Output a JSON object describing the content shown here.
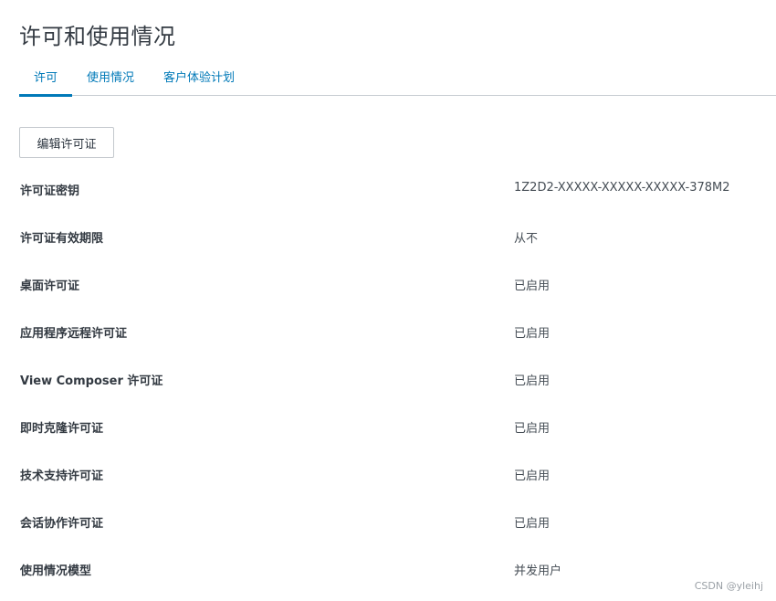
{
  "page": {
    "title": "许可和使用情况"
  },
  "tabs": [
    {
      "label": "许可",
      "active": true
    },
    {
      "label": "使用情况",
      "active": false
    },
    {
      "label": "客户体验计划",
      "active": false
    }
  ],
  "actions": {
    "edit_license_label": "编辑许可证"
  },
  "license_rows": [
    {
      "label": "许可证密钥",
      "value": "1Z2D2-XXXXX-XXXXX-XXXXX-378M2"
    },
    {
      "label": "许可证有效期限",
      "value": "从不"
    },
    {
      "label": "桌面许可证",
      "value": "已启用"
    },
    {
      "label": "应用程序远程许可证",
      "value": "已启用"
    },
    {
      "label": "View Composer 许可证",
      "value": "已启用"
    },
    {
      "label": "即时克隆许可证",
      "value": "已启用"
    },
    {
      "label": "技术支持许可证",
      "value": "已启用"
    },
    {
      "label": "会话协作许可证",
      "value": "已启用"
    },
    {
      "label": "使用情况模型",
      "value": "并发用户"
    }
  ],
  "watermark": "CSDN @yleihj",
  "colors": {
    "accent": "#0079b8",
    "divider": "#c9ced3",
    "text": "#333a42"
  }
}
